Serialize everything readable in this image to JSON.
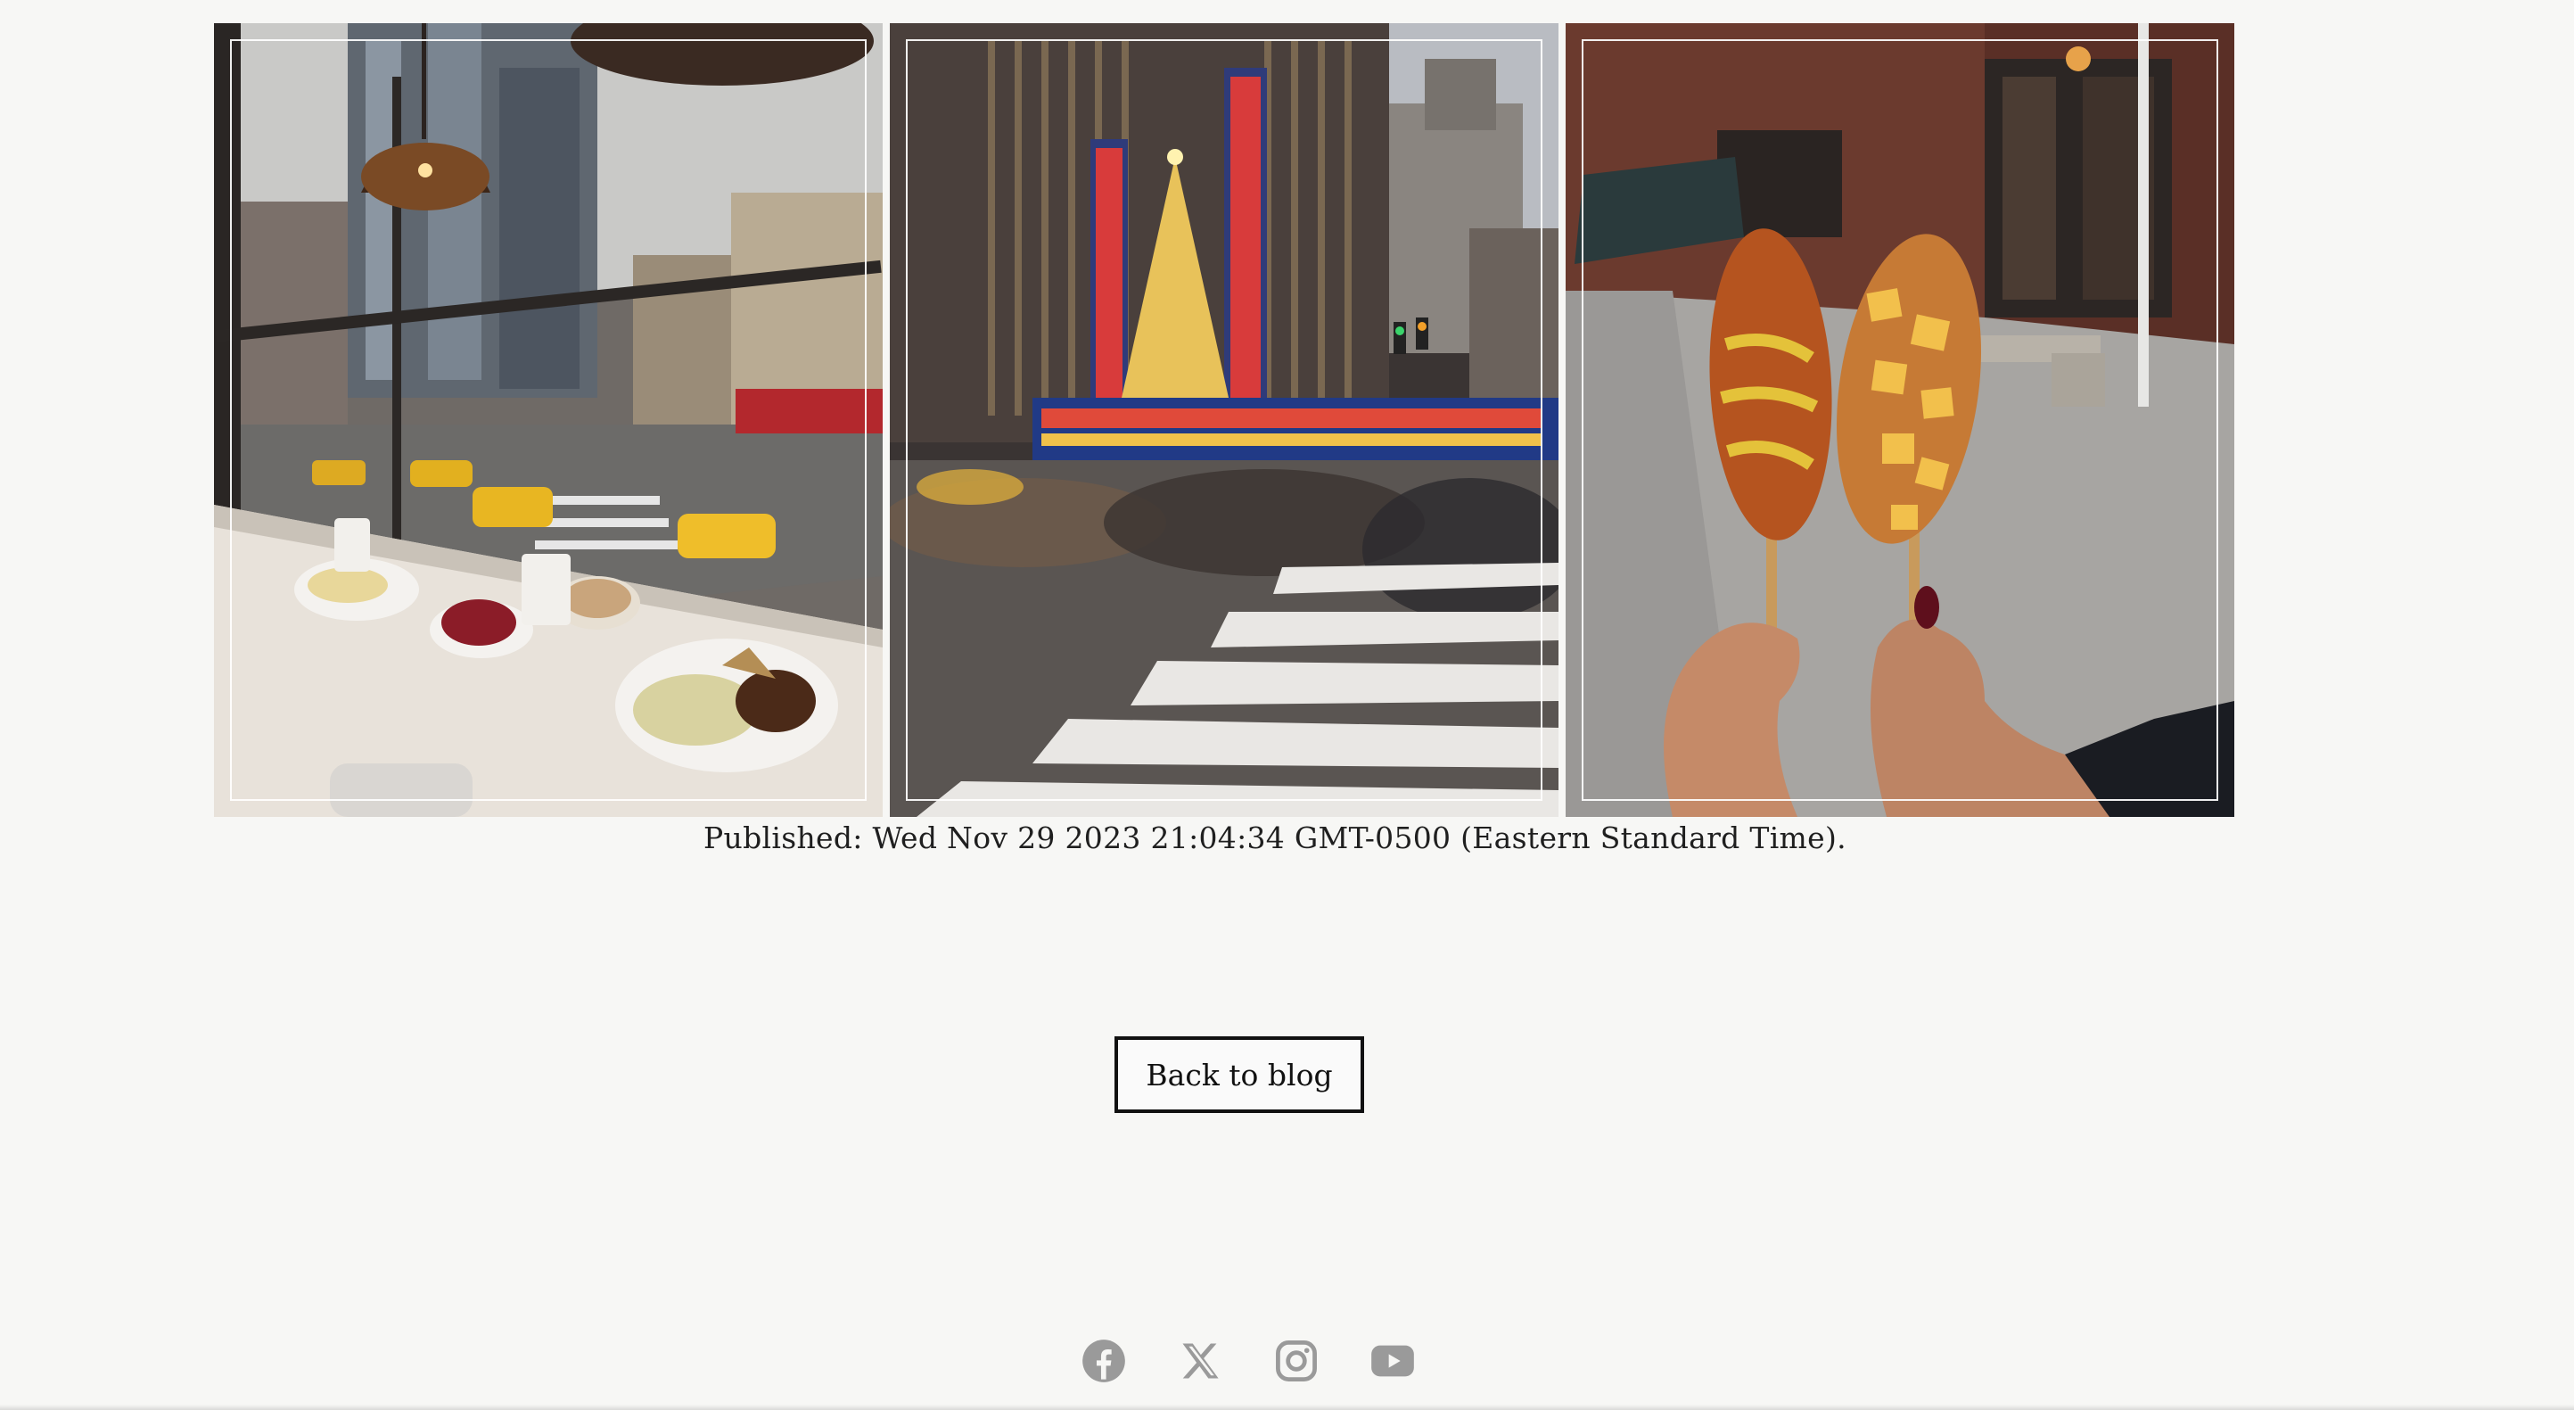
{
  "gallery": {
    "images": [
      {
        "alt": "Cafe window counter with breakfast plates overlooking a street with taxis"
      },
      {
        "alt": "Radio City Music Hall with crowd crossing the crosswalk"
      },
      {
        "alt": "Two hands holding corn dogs on a city sidewalk"
      }
    ]
  },
  "post": {
    "published": "Published: Wed Nov 29 2023 21:04:34 GMT-0500 (Eastern Standard Time)."
  },
  "actions": {
    "back_label": "Back to blog"
  },
  "social": {
    "icons": [
      "facebook-icon",
      "x-icon",
      "instagram-icon",
      "youtube-icon"
    ],
    "icon_color": "#9a9a9a"
  },
  "colors": {
    "background": "#f7f7f5",
    "text": "#1f1f1f",
    "button_border": "#111111"
  }
}
